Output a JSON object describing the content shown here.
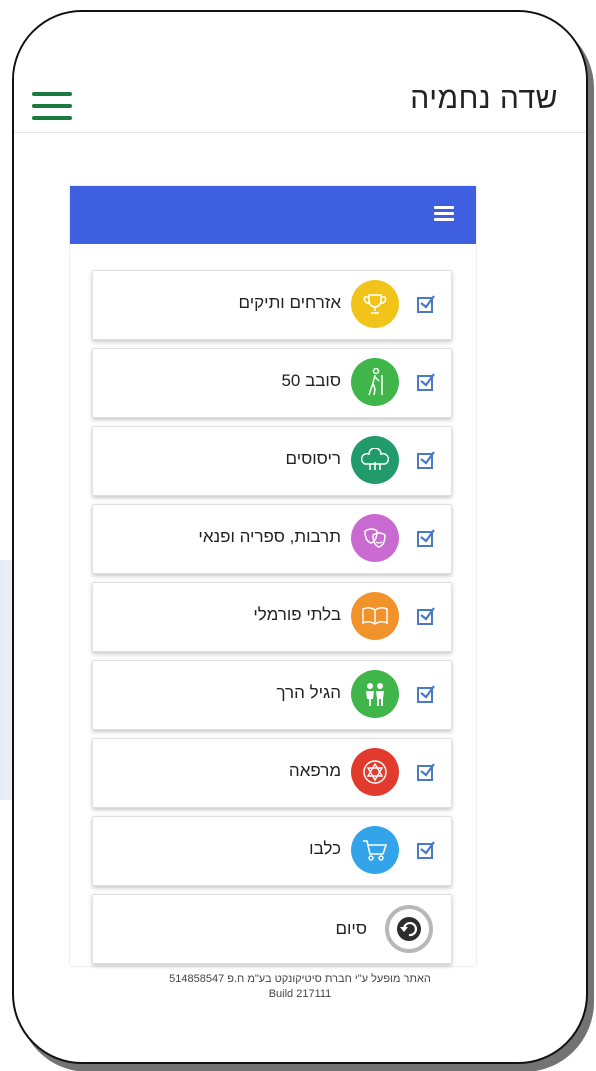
{
  "header": {
    "title": "שדה נחמיה"
  },
  "items": [
    {
      "label": "אזרחים ותיקים",
      "icon": "trophy-icon",
      "color": "#f2c419",
      "checked": true
    },
    {
      "label": "סובב 50",
      "icon": "hiker-icon",
      "color": "#3fb54a",
      "checked": true
    },
    {
      "label": "ריסוסים",
      "icon": "trees-icon",
      "color": "#219a6c",
      "checked": true
    },
    {
      "label": "תרבות, ספריה ופנאי",
      "icon": "theater-masks-icon",
      "color": "#c86ad0",
      "checked": true
    },
    {
      "label": "בלתי פורמלי",
      "icon": "book-icon",
      "color": "#f2922a",
      "checked": true
    },
    {
      "label": "הגיל הרך",
      "icon": "children-icon",
      "color": "#3fb54a",
      "checked": true
    },
    {
      "label": "מרפאה",
      "icon": "star-of-david-icon",
      "color": "#e23b2e",
      "checked": true
    },
    {
      "label": "כלבו",
      "icon": "shopping-cart-icon",
      "color": "#34a4ea",
      "checked": true
    }
  ],
  "finish": {
    "label": "סיום",
    "icon": "undo-icon"
  },
  "footer": {
    "line1": "האתר מופעל ע\"י חברת סיטיקונקט בע\"מ ח.פ 514858547",
    "line2": "Build 217111"
  },
  "colors": {
    "header_accent": "#3d5fe0",
    "menu_green": "#1a7a3e",
    "checkbox": "#4a79c8"
  }
}
